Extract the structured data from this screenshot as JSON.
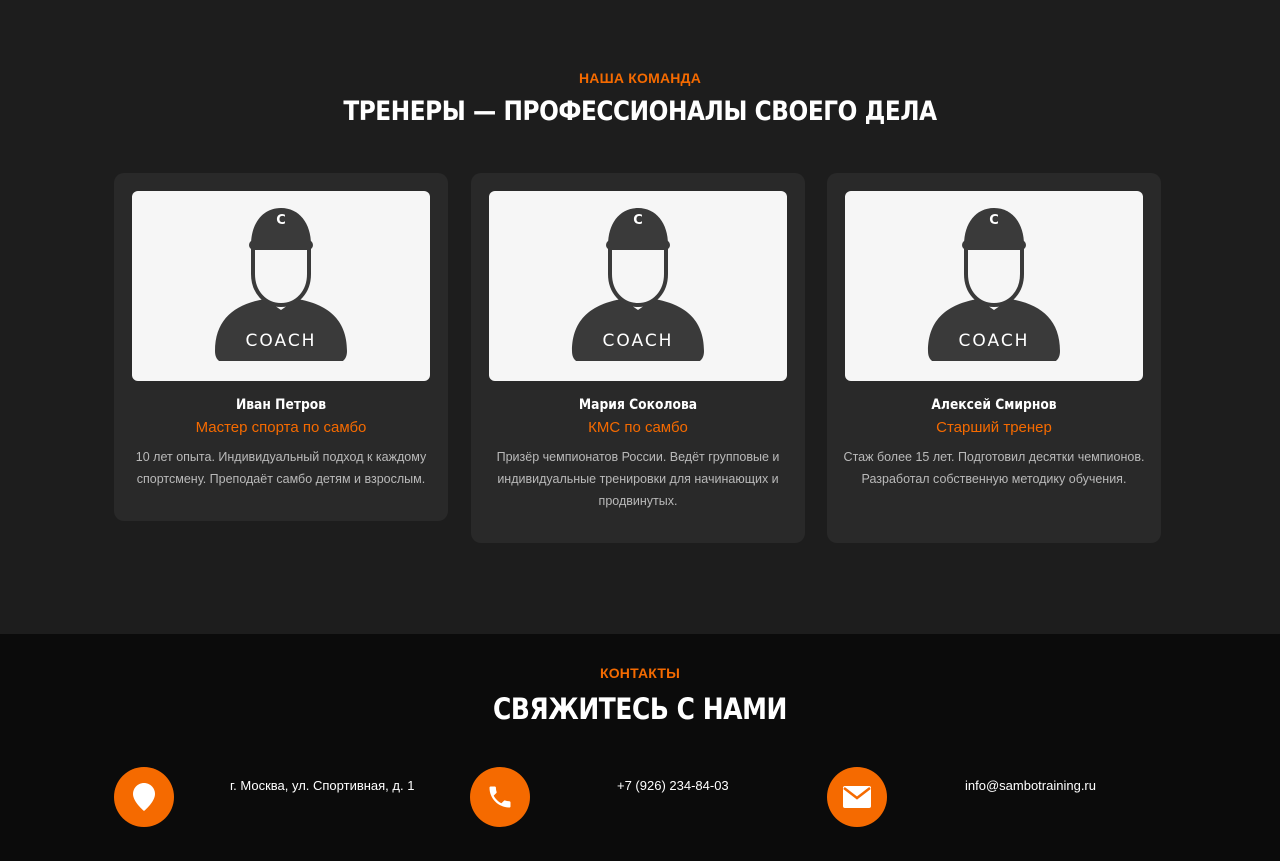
{
  "team_section": {
    "eyebrow": "НАША КОМАНДА",
    "title": "ТРЕНЕРЫ — ПРОФЕССИОНАЛЫ СВОЕГО ДЕЛА",
    "coaches": [
      {
        "shirt_label": "COACH",
        "cap_letter": "С",
        "name": "Иван Петров",
        "role": "Мастер спорта по самбо",
        "description": "10 лет опыта. Индивидуальный подход к каждому спортсмену. Преподаёт самбо детям и взрослым."
      },
      {
        "shirt_label": "COACH",
        "cap_letter": "С",
        "name": "Мария Соколова",
        "role": "КМС по самбо",
        "description": "Призёр чемпионатов России. Ведёт групповые и индивидуальные тренировки для начинающих и продвинутых."
      },
      {
        "shirt_label": "COACH",
        "cap_letter": "С",
        "name": "Алексей Смирнов",
        "role": "Старший тренер",
        "description": "Стаж более 15 лет. Подготовил десятки чемпионов. Разработал собственную методику обучения."
      }
    ]
  },
  "contacts_section": {
    "eyebrow": "КОНТАКТЫ",
    "title": "СВЯЖИТЕСЬ С НАМИ",
    "items": [
      {
        "icon": "location-pin-icon",
        "text": "г. Москва, ул. Спортивная, д. 1"
      },
      {
        "icon": "phone-icon",
        "text": "+7 (926) 234-84-03"
      },
      {
        "icon": "email-icon",
        "text": "info@sambotraining.ru"
      }
    ]
  },
  "colors": {
    "accent": "#f56a00",
    "team_background": "#1d1d1d",
    "card_background": "#292929",
    "footer_background": "#0b0b0b"
  }
}
